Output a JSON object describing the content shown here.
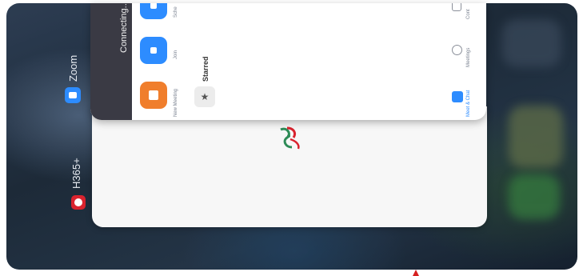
{
  "app_switcher": {
    "apps": [
      {
        "label": "Zoom",
        "icon": "zoom-app-icon",
        "accent": "#2d8cff"
      },
      {
        "label": "H365+",
        "icon": "h365-app-icon",
        "accent": "#d9232e"
      }
    ]
  },
  "zoom_card": {
    "status": "Connecting...",
    "tiles": [
      {
        "label": "New Meeting",
        "icon": "camera-icon",
        "color": "#f07e2c"
      },
      {
        "label": "Join",
        "icon": "plus-icon",
        "color": "#2d8cff"
      },
      {
        "label": "Sche",
        "icon": "calendar-icon",
        "color": "#2d8cff"
      }
    ],
    "section_title": "Starred",
    "star_icon": "star-icon",
    "nav": [
      {
        "label": "Meet & Chat",
        "icon": "chat-icon"
      },
      {
        "label": "Meetings",
        "icon": "clock-icon"
      },
      {
        "label": "Cont",
        "icon": "contacts-icon"
      }
    ]
  }
}
